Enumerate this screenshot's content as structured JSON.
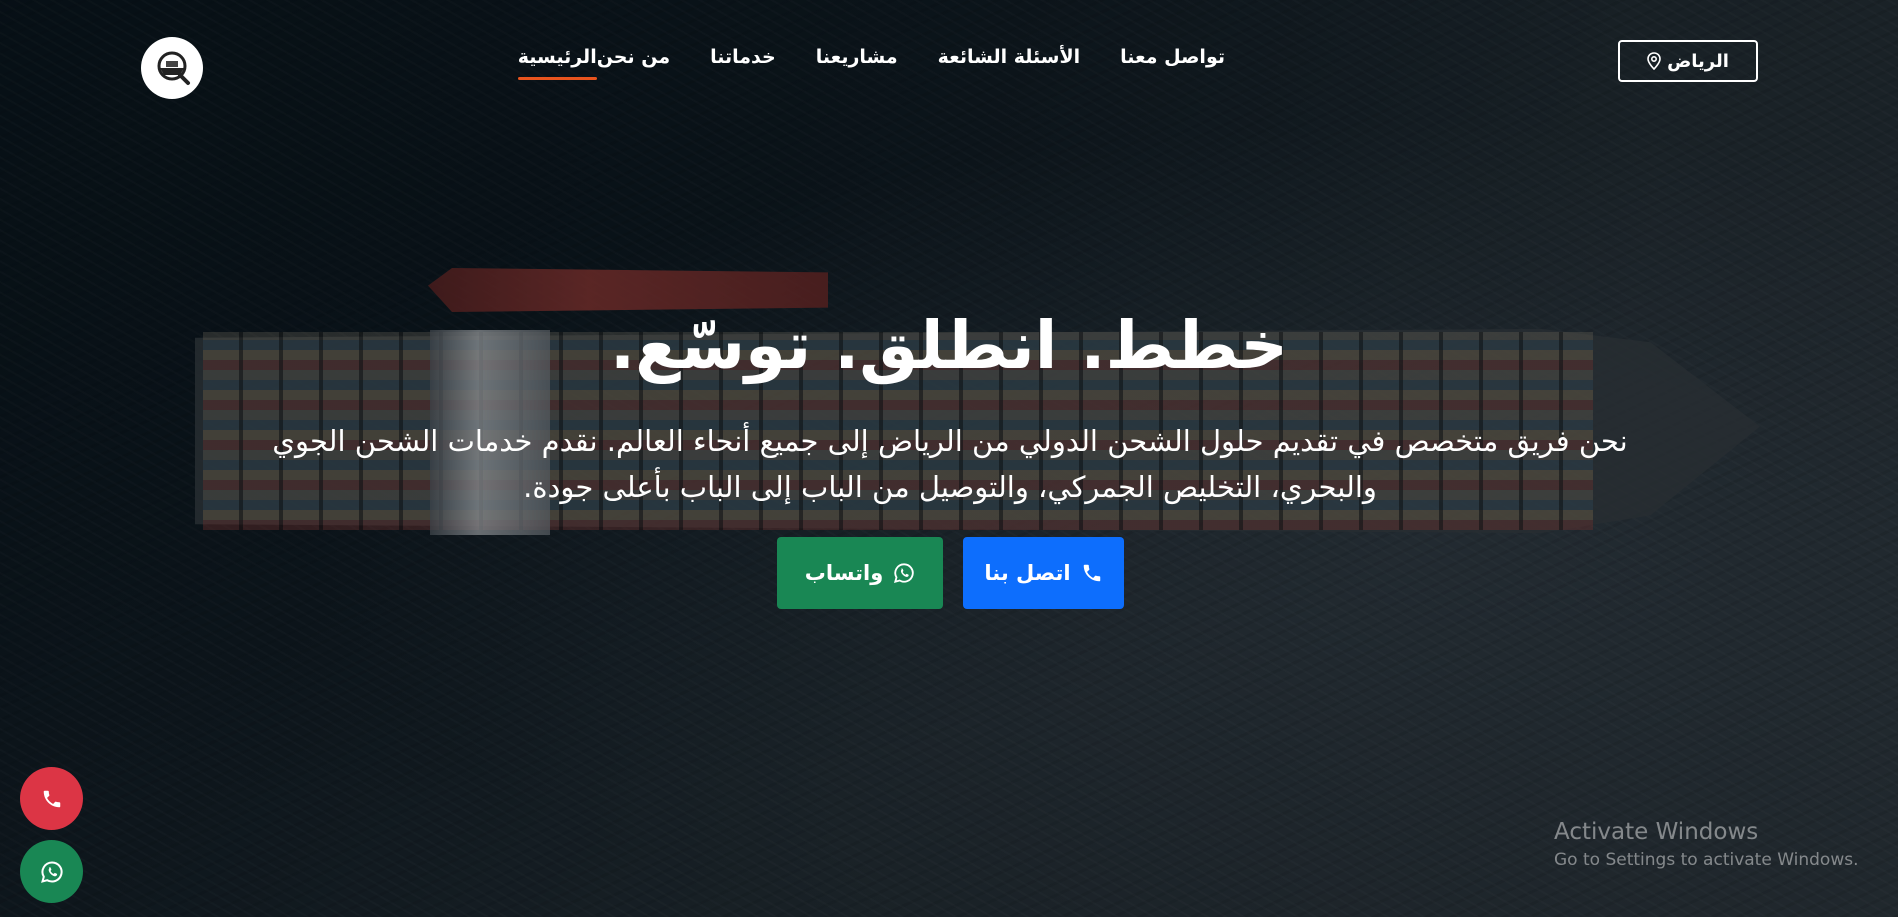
{
  "header": {
    "logo_icon": "ship-logo-icon",
    "nav": [
      {
        "label": "الرئيسية",
        "active": true
      },
      {
        "label": "من نحن",
        "active": false
      },
      {
        "label": "خدماتنا",
        "active": false
      },
      {
        "label": "مشاريعنا",
        "active": false
      },
      {
        "label": "الأسئلة الشائعة",
        "active": false
      },
      {
        "label": "تواصل معنا",
        "active": false
      }
    ],
    "city_button": {
      "label": "الرياض",
      "icon": "location-pin-icon"
    },
    "active_underline_color": "#e8541e"
  },
  "hero": {
    "title": "خطط. انطلق. توسّع.",
    "description_line1": "نحن فريق متخصص في تقديم حلول الشحن الدولي من الرياض إلى جميع أنحاء العالم. نقدم خدمات الشحن الجوي",
    "description_line2": "والبحري، التخليص الجمركي، والتوصيل من الباب إلى الباب بأعلى جودة.",
    "call_button": {
      "label": "اتصل بنا",
      "icon": "phone-icon",
      "color": "#0d6efd"
    },
    "whatsapp_button": {
      "label": "واتساب",
      "icon": "whatsapp-icon",
      "color": "#198754"
    }
  },
  "floating": {
    "call": {
      "icon": "phone-icon",
      "color": "#dc3545"
    },
    "whatsapp": {
      "icon": "whatsapp-icon",
      "color": "#198754"
    }
  },
  "watermark": {
    "title": "Activate Windows",
    "subtitle": "Go to Settings to activate Windows."
  }
}
